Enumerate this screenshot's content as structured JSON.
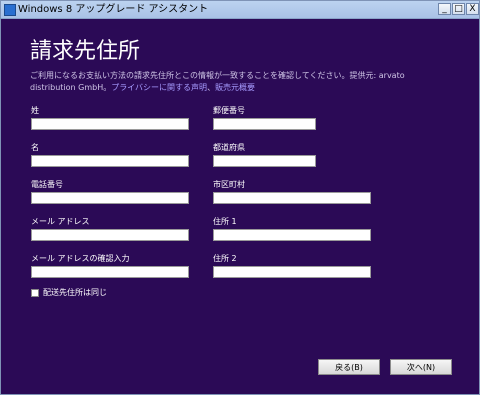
{
  "window": {
    "title": "Windows 8 アップグレード アシスタント",
    "minimize_label": "_",
    "maximize_label": "□",
    "close_label": "X"
  },
  "page": {
    "title": "請求先住所",
    "description_before": "ご利用になるお支払い方法の請求先住所とこの情報が一致することを確認してください。提供元: arvato distribution GmbH。",
    "privacy_link": "プライバシーに関する声明",
    "separator": "、",
    "sales_link": "販売元概要"
  },
  "fields": {
    "last_name": {
      "label": "姓",
      "value": ""
    },
    "first_name": {
      "label": "名",
      "value": ""
    },
    "phone": {
      "label": "電話番号",
      "value": ""
    },
    "email": {
      "label": "メール アドレス",
      "value": ""
    },
    "email_confirm": {
      "label": "メール アドレスの確認入力",
      "value": ""
    },
    "postal_code": {
      "label": "郵便番号",
      "value": ""
    },
    "prefecture": {
      "label": "都道府県",
      "value": ""
    },
    "city": {
      "label": "市区町村",
      "value": ""
    },
    "address1": {
      "label": "住所 1",
      "value": ""
    },
    "address2": {
      "label": "住所 2",
      "value": ""
    }
  },
  "shipping_same": {
    "label": "配送先住所は同じ",
    "checked": false
  },
  "buttons": {
    "back": "戻る(B)",
    "next": "次へ(N)"
  },
  "colors": {
    "background": "#2b0a56",
    "link": "#a79bff",
    "titlebar": "#bcd3f0"
  }
}
